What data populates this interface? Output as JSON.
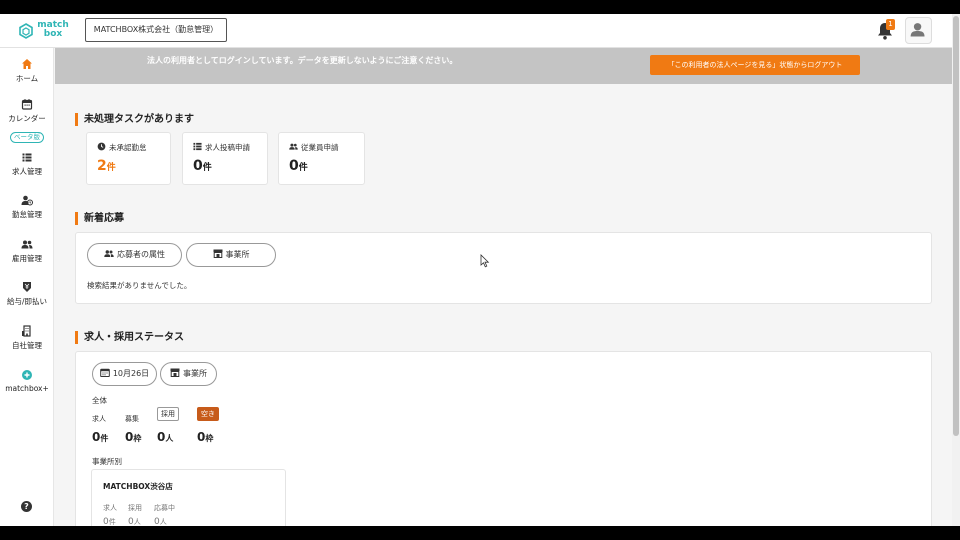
{
  "header": {
    "logo_line1": "match",
    "logo_line2": "box",
    "company": "MATCHBOX株式会社（勤怠管理）",
    "notification_count": "1"
  },
  "sidebar": {
    "items": [
      {
        "label": "ホーム",
        "icon": "home-icon"
      },
      {
        "label": "カレンダー",
        "icon": "calendar-icon",
        "badge": "ベータ版"
      },
      {
        "label": "求人管理",
        "icon": "list-icon"
      },
      {
        "label": "勤怠管理",
        "icon": "person-clock-icon"
      },
      {
        "label": "雇用管理",
        "icon": "people-icon"
      },
      {
        "label": "給与/即払い",
        "icon": "payment-icon"
      },
      {
        "label": "自社管理",
        "icon": "building-icon"
      },
      {
        "label": "matchbox+",
        "icon": "plus-circle-icon"
      }
    ],
    "help": "?"
  },
  "notice": {
    "text": "法人の利用者としてログインしています。データを更新しないようにご注意ください。",
    "button": "「この利用者の法人ページを見る」状態からログアウト"
  },
  "tasks": {
    "title": "未処理タスクがあります",
    "cards": [
      {
        "label": "未承認勤怠",
        "count": "2",
        "unit": "件"
      },
      {
        "label": "求人投稿申請",
        "count": "0",
        "unit": "件"
      },
      {
        "label": "従業員申請",
        "count": "0",
        "unit": "件"
      }
    ]
  },
  "applications": {
    "title": "新着応募",
    "filter1": "応募者の属性",
    "filter2": "事業所",
    "empty": "検索結果がありませんでした。"
  },
  "status": {
    "title": "求人・採用ステータス",
    "date_filter": "10月26日",
    "office_filter": "事業所",
    "overall_label": "全体",
    "stats": [
      {
        "label": "求人",
        "value": "0",
        "unit": "件"
      },
      {
        "label": "募集",
        "value": "0",
        "unit": "枠"
      },
      {
        "label": "採用",
        "value": "0",
        "unit": "人"
      },
      {
        "label": "空き",
        "value": "0",
        "unit": "枠"
      }
    ],
    "by_office_label": "事業所別",
    "office": {
      "name": "MATCHBOX渋谷店",
      "heads": [
        "求人",
        "採用",
        "応募中"
      ],
      "values": [
        {
          "value": "0",
          "unit": "件"
        },
        {
          "value": "0",
          "unit": "人"
        },
        {
          "value": "0",
          "unit": "人"
        }
      ]
    }
  },
  "colors": {
    "accent": "#f07a13",
    "brand": "#2fb5b5",
    "notice_bg": "#c4c4c4"
  }
}
